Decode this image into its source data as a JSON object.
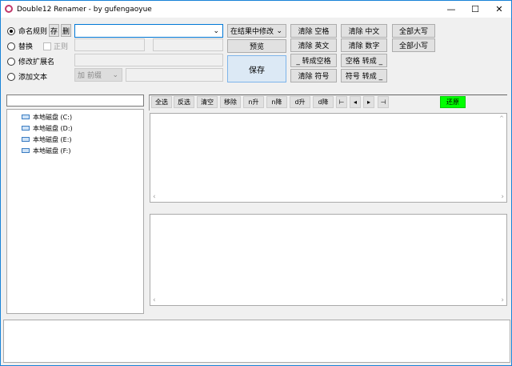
{
  "window": {
    "title": "Double12 Renamer - by gufengaoyue",
    "minimize": "—",
    "maximize": "☐",
    "close": "✕"
  },
  "modes": [
    {
      "label": "命名规则",
      "selected": true
    },
    {
      "label": "替换",
      "selected": false
    },
    {
      "label": "修改扩展名",
      "selected": false
    },
    {
      "label": "添加文本",
      "selected": false
    }
  ],
  "rule_buttons": {
    "save": "存",
    "delete": "删"
  },
  "regex_label": "正则",
  "rule_input": {
    "value": ""
  },
  "add_text_position": "加 前缀",
  "scope_select": "在结果中修改",
  "preview": "预览",
  "save": "保存",
  "actions": [
    [
      "清除 空格",
      "清除 中文",
      "全部大写"
    ],
    [
      "清除 英文",
      "清除 数字",
      "全部小写"
    ],
    [
      "_ 转成空格",
      "空格 转成 _"
    ],
    [
      "清除 符号",
      "符号 转成 _"
    ]
  ],
  "drives": [
    "本地磁盘 (C:)",
    "本地磁盘 (D:)",
    "本地磁盘 (E:)",
    "本地磁盘 (F:)"
  ],
  "toolbar": [
    "全选",
    "反选",
    "清空",
    "移除",
    "n升",
    "n降",
    "d升",
    "d降"
  ],
  "toolbar_icons": [
    "first-icon",
    "prev-icon",
    "next-icon",
    "last-icon"
  ],
  "toolbar_icon_glyphs": [
    "⊢",
    "◂",
    "▸",
    "⊣"
  ],
  "restore": "还原",
  "restore_color": "#00ff00"
}
